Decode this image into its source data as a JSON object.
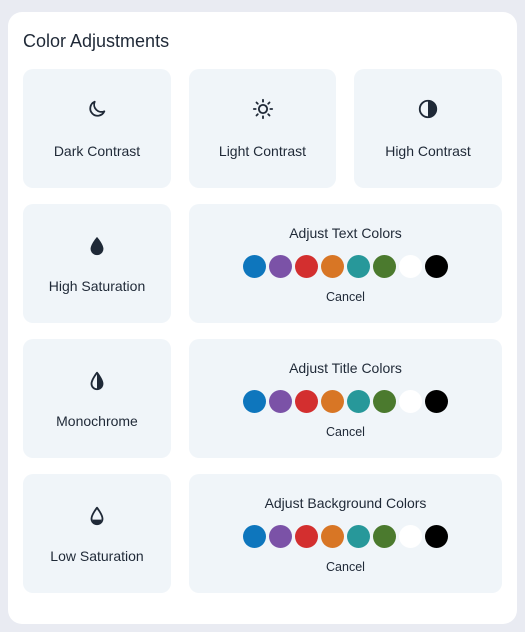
{
  "panel": {
    "title": "Color Adjustments"
  },
  "tiles": [
    {
      "label": "Dark Contrast",
      "icon": "moon-icon"
    },
    {
      "label": "Light Contrast",
      "icon": "sun-icon"
    },
    {
      "label": "High Contrast",
      "icon": "half-circle-icon"
    },
    {
      "label": "High Saturation",
      "icon": "filled-drop-icon"
    },
    {
      "label": "Monochrome",
      "icon": "half-drop-icon"
    },
    {
      "label": "Low Saturation",
      "icon": "outline-drop-icon"
    }
  ],
  "color_groups": [
    {
      "title": "Adjust Text Colors",
      "cancel_label": "Cancel"
    },
    {
      "title": "Adjust Title Colors",
      "cancel_label": "Cancel"
    },
    {
      "title": "Adjust Background Colors",
      "cancel_label": "Cancel"
    }
  ],
  "swatch_colors": [
    "#0e76bd",
    "#7b52a7",
    "#d32f2f",
    "#d87625",
    "#27989a",
    "#4b7a2e",
    "#ffffff",
    "#000000"
  ],
  "theme": {
    "tile_background": "#f0f5f9",
    "text_color": "#1f2937",
    "page_background": "#e9ebf2"
  }
}
